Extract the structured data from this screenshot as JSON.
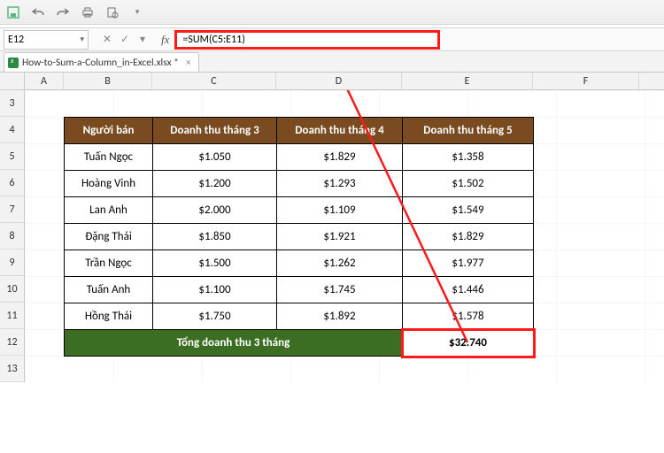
{
  "qat": {
    "icons": [
      "save",
      "undo",
      "redo",
      "print",
      "print-preview",
      "caret"
    ]
  },
  "namebox": {
    "value": "E12"
  },
  "formula_bar": {
    "fx_label": "fx",
    "formula": "=SUM(C5:E11)",
    "cancel": "✕",
    "confirm": "✓",
    "dropdown": "▾"
  },
  "file_tab": {
    "name": "How-to-Sum-a-Column_in-Excel.xlsx *"
  },
  "columns": [
    "A",
    "B",
    "C",
    "D",
    "E",
    "F"
  ],
  "rows": [
    "3",
    "4",
    "5",
    "6",
    "7",
    "8",
    "9",
    "10",
    "11",
    "12",
    "13"
  ],
  "table": {
    "headers": [
      "Người bán",
      "Doanh thu tháng 3",
      "Doanh thu tháng 4",
      "Doanh thu tháng 5"
    ],
    "data": [
      [
        "Tuấn Ngọc",
        "$1.050",
        "$1.829",
        "$1.358"
      ],
      [
        "Hoàng Vinh",
        "$1.200",
        "$1.293",
        "$1.502"
      ],
      [
        "Lan Anh",
        "$2.000",
        "$1.109",
        "$1.549"
      ],
      [
        "Đặng Thái",
        "$1.850",
        "$1.921",
        "$1.829"
      ],
      [
        "Trần Ngọc",
        "$1.500",
        "$1.262",
        "$1.977"
      ],
      [
        "Tuấn Anh",
        "$1.100",
        "$1.745",
        "$1.446"
      ],
      [
        "Hồng Thái",
        "$1.750",
        "$1.892",
        "$1.578"
      ]
    ],
    "total_label": "Tổng doanh thu 3 tháng",
    "total_value": "$32.740"
  },
  "colors": {
    "header_bg": "#7a4b20",
    "total_bg": "#3b6e22",
    "highlight": "#ff1a1a"
  }
}
